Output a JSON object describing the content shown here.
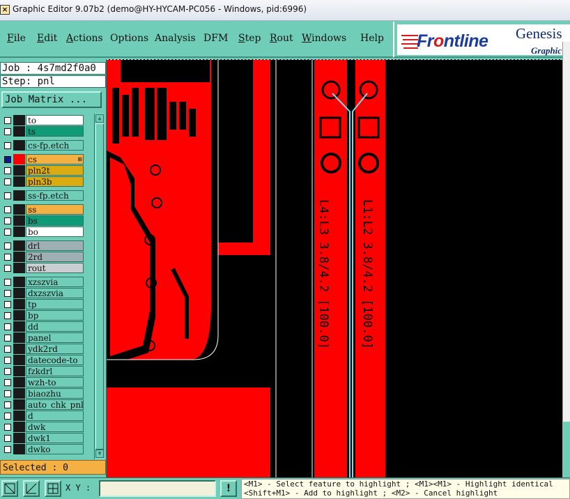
{
  "window": {
    "title": "Graphic Editor 9.07b2 (demo@HY-HYCAM-PC056 - Windows, pid:6996)",
    "icon": "app-icon-x"
  },
  "menu": {
    "items": [
      "File",
      "Edit",
      "Actions",
      "Options",
      "Analysis",
      "DFM",
      "Step",
      "Rout",
      "Windows",
      "Help"
    ]
  },
  "brand": {
    "logo_pre": "Fr",
    "logo_dot": "o",
    "logo_post": "ntline",
    "product": "Genesis",
    "product2": "Graphic"
  },
  "job": {
    "job_line": "Job : 4s7md2f0a0",
    "step_line": "Step: pnl",
    "matrix_button": "Job Matrix ..."
  },
  "layers": [
    {
      "name": "to",
      "color": "#ffffff",
      "checked": false,
      "affected": false
    },
    {
      "name": "ts",
      "color": "#0f9a78",
      "checked": false,
      "affected": false
    },
    {
      "name": "cs-fp.etch",
      "color": "#6fcdb8",
      "checked": false,
      "affected": false
    },
    {
      "name": "cs",
      "color": "#f4b042",
      "checked": true,
      "affected": true,
      "work": true
    },
    {
      "name": "pln2t",
      "color": "#dcaa12",
      "checked": false,
      "affected": false
    },
    {
      "name": "pln3b",
      "color": "#dcaa12",
      "checked": false,
      "affected": false
    },
    {
      "name": "ss-fp.etch",
      "color": "#6fcdb8",
      "checked": false,
      "affected": false
    },
    {
      "name": "ss",
      "color": "#f4b042",
      "checked": false,
      "affected": false
    },
    {
      "name": "bs",
      "color": "#0f9a78",
      "checked": false,
      "affected": false
    },
    {
      "name": "bo",
      "color": "#ffffff",
      "checked": false,
      "affected": false
    },
    {
      "name": "drl",
      "color": "#9fb0b4",
      "checked": false,
      "affected": false
    },
    {
      "name": "2rd",
      "color": "#9fb0b4",
      "checked": false,
      "affected": false
    },
    {
      "name": "rout",
      "color": "#c9cfd0",
      "checked": false,
      "affected": false
    },
    {
      "name": "xzszvia",
      "color": "#6fcdb8",
      "checked": false,
      "affected": false
    },
    {
      "name": "dxzszvia",
      "color": "#6fcdb8",
      "checked": false,
      "affected": false
    },
    {
      "name": "tp",
      "color": "#6fcdb8",
      "checked": false,
      "affected": false
    },
    {
      "name": "bp",
      "color": "#6fcdb8",
      "checked": false,
      "affected": false
    },
    {
      "name": "dd",
      "color": "#6fcdb8",
      "checked": false,
      "affected": false
    },
    {
      "name": "panel",
      "color": "#6fcdb8",
      "checked": false,
      "affected": false
    },
    {
      "name": "ydk2rd",
      "color": "#6fcdb8",
      "checked": false,
      "affected": false
    },
    {
      "name": "datecode-to",
      "color": "#6fcdb8",
      "checked": false,
      "affected": false
    },
    {
      "name": "fzkdrl",
      "color": "#6fcdb8",
      "checked": false,
      "affected": false
    },
    {
      "name": "wzh-to",
      "color": "#6fcdb8",
      "checked": false,
      "affected": false
    },
    {
      "name": "biaozhu",
      "color": "#6fcdb8",
      "checked": false,
      "affected": false
    },
    {
      "name": "auto_chk_pnl",
      "color": "#6fcdb8",
      "checked": false,
      "affected": false
    },
    {
      "name": "d",
      "color": "#6fcdb8",
      "checked": false,
      "affected": false
    },
    {
      "name": "dwk",
      "color": "#6fcdb8",
      "checked": false,
      "affected": false
    },
    {
      "name": "dwk1",
      "color": "#6fcdb8",
      "checked": false,
      "affected": false
    },
    {
      "name": "dwko",
      "color": "#6fcdb8",
      "checked": false,
      "affected": false
    }
  ],
  "selected": "Selected : 0",
  "canvas": {
    "text_left": "L4:L3 3.8/4.2 [100.0]",
    "text_right": "L1:L2 3.8/4.2 [100.0]",
    "feature_color": "#ff0000",
    "background_color": "#000000",
    "highlight_color": "#7fd8e8"
  },
  "bottom": {
    "xy_label": "X Y :",
    "xy_value": "",
    "warn_label": "!",
    "help_line1": "<M1> - Select feature to highlight ; <M1><M1> - Highlight identical",
    "help_line2": "<Shift+M1> - Add to highlight ; <M2> - Cancel highlight"
  }
}
